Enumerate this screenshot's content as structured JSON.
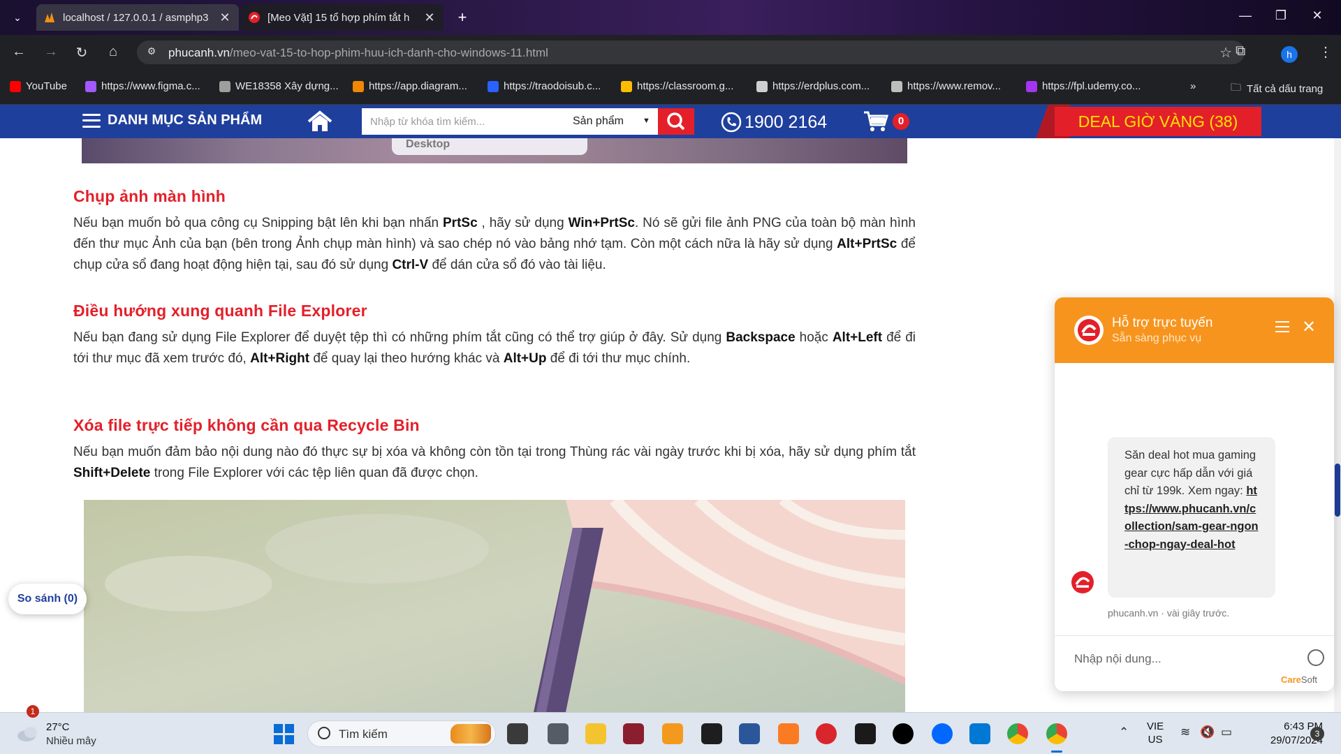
{
  "browser": {
    "tabs": [
      {
        "title": "localhost / 127.0.0.1 / asmphp3",
        "active": false
      },
      {
        "title": "[Meo Vặt] 15 tổ hợp phím tắt h",
        "active": true
      }
    ],
    "url_domain": "phucanh.vn",
    "url_path": "/meo-vat-15-to-hop-phim-huu-ich-danh-cho-windows-11.html",
    "profile_initial": "h",
    "bookmarks": [
      {
        "label": "YouTube",
        "color": "#ff0000"
      },
      {
        "label": "https://www.figma.c...",
        "color": "#a259ff"
      },
      {
        "label": "WE18358 Xây dựng...",
        "color": "#9e9e9e"
      },
      {
        "label": "https://app.diagram...",
        "color": "#f08705"
      },
      {
        "label": "https://traodoisub.c...",
        "color": "#2962ff"
      },
      {
        "label": "https://classroom.g...",
        "color": "#fbbc04"
      },
      {
        "label": "https://erdplus.com...",
        "color": "#cfcfcf"
      },
      {
        "label": "https://www.remov...",
        "color": "#bdbdbd"
      },
      {
        "label": "https://fpl.udemy.co...",
        "color": "#a435f0"
      }
    ],
    "all_bookmarks": "Tất cả dấu trang"
  },
  "site": {
    "menu_label": "DANH MỤC SẢN PHẨM",
    "search_placeholder": "Nhập từ khóa tìm kiếm...",
    "search_category": "Sản phẩm",
    "phone": "1900 2164",
    "cart_count": "0",
    "deal_label": "DEAL GIỜ VÀNG (38)",
    "brand_color": "#1f3f9c",
    "accent_color": "#e3202a"
  },
  "article": {
    "top_image_caption": "Desktop",
    "sections": [
      {
        "heading": "Chụp ảnh màn hình",
        "p": [
          "Nếu bạn muốn bỏ qua công cụ Snipping bật lên khi bạn nhấn ",
          "PrtSc",
          " , hãy sử dụng ",
          "Win+PrtSc",
          ". Nó sẽ gửi file ảnh PNG của toàn bộ màn hình đến thư mục Ảnh của bạn (bên trong Ảnh chụp màn hình) và sao chép nó vào bảng nhớ tạm. Còn một cách nữa là hãy sử dụng ",
          "Alt+PrtSc",
          " để chụp cửa sổ đang hoạt động hiện tại, sau đó sử dụng ",
          "Ctrl-V",
          " để dán cửa sổ đó vào tài liệu."
        ]
      },
      {
        "heading": "Điều hướng xung quanh File Explorer",
        "p": [
          "Nếu bạn đang sử dụng File Explorer để duyệt tệp thì có những phím tắt cũng có thể trợ giúp ở đây. Sử dụng ",
          "Backspace",
          " hoặc ",
          "Alt+Left",
          " để đi tới thư mục đã xem trước đó, ",
          "Alt+Right",
          " để quay lại theo hướng khác và ",
          "Alt+Up",
          " để đi tới thư mục chính."
        ]
      },
      {
        "heading": "Xóa file trực tiếp không cần qua Recycle Bin",
        "p": [
          "Nếu bạn muốn đảm bảo nội dung nào đó thực sự bị xóa và không còn tồn tại trong Thùng rác vài ngày trước khi bị xóa, hãy sử dụng phím tắt ",
          "Shift+Delete",
          " trong File Explorer với các tệp liên quan đã được chọn."
        ]
      }
    ]
  },
  "compare": "So sánh (0)",
  "chat": {
    "title": "Hỗ trợ trực tuyến",
    "subtitle": "Sẵn sàng phục vụ",
    "message": "Săn deal hot mua gaming gear cực hấp dẫn với giá chỉ từ 199k. Xem ngay:",
    "link": "https://www.phucanh.vn/collection/sam-gear-ngon-chop-ngay-deal-hot",
    "meta": "phucanh.vn · vài giây trước.",
    "input_placeholder": "Nhập nội dung...",
    "brand_a": "Care",
    "brand_b": "Soft",
    "header_color": "#f7941d"
  },
  "taskbar": {
    "weather_badge": "1",
    "temperature": "27°C",
    "condition": "Nhiều mây",
    "search_label": "Tìm kiếm",
    "lang_line1": "VIE",
    "lang_line2": "US",
    "time": "6:43 PM",
    "date": "29/07/2024",
    "notifications": "3"
  }
}
